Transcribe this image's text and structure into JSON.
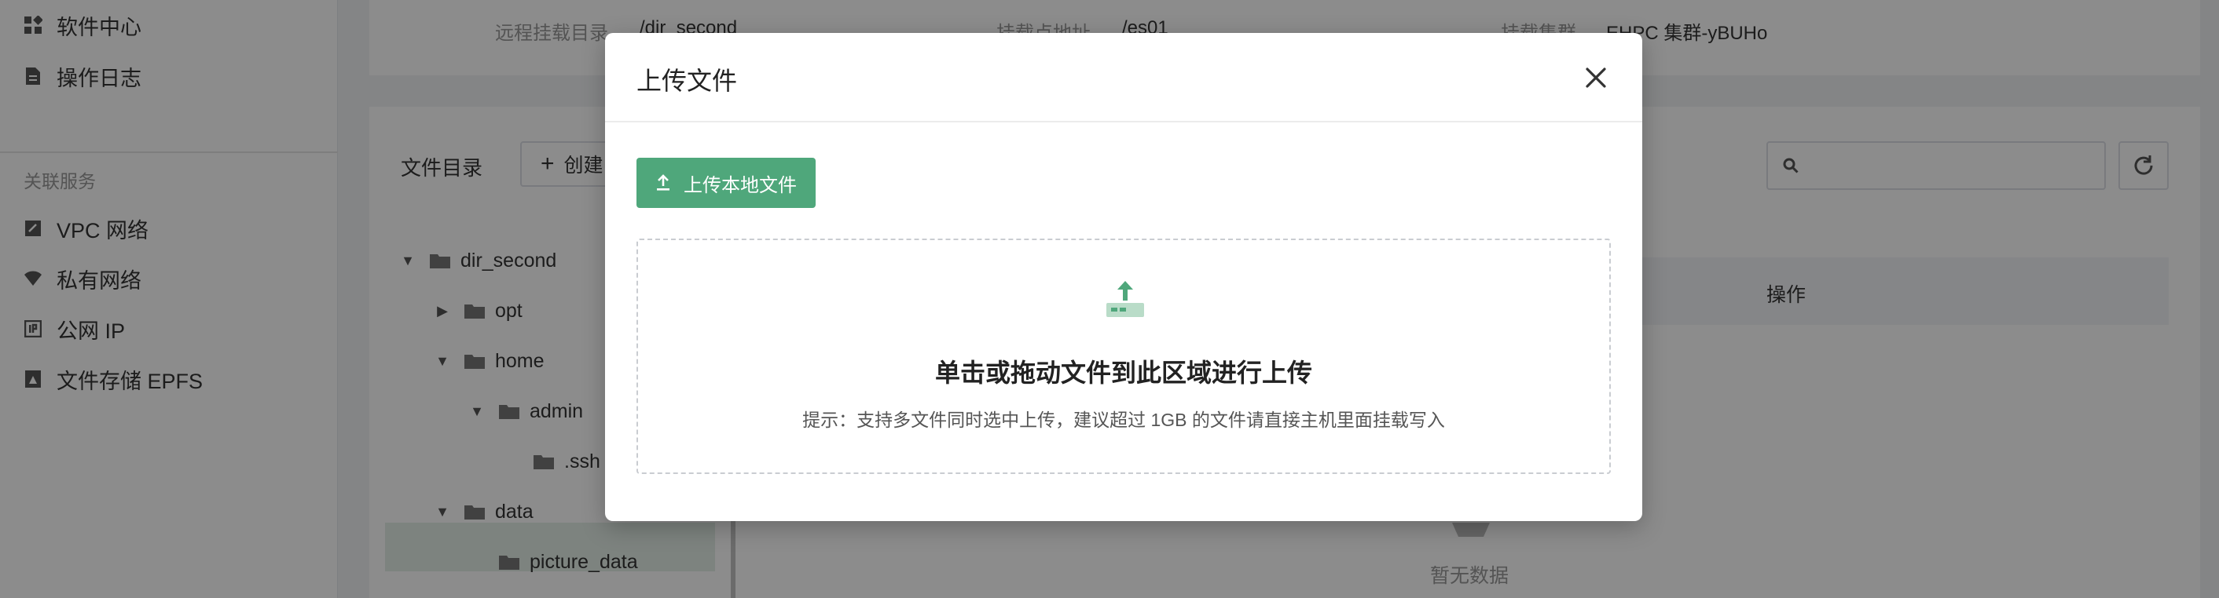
{
  "sidebar": {
    "items_top": [
      {
        "label": "软件中心",
        "icon": "apps-icon"
      },
      {
        "label": "操作日志",
        "icon": "log-icon"
      }
    ],
    "section_title": "关联服务",
    "items_related": [
      {
        "label": "VPC 网络",
        "icon": "vpc-icon"
      },
      {
        "label": "私有网络",
        "icon": "wifi-icon"
      },
      {
        "label": "公网 IP",
        "icon": "ip-icon"
      },
      {
        "label": "文件存储 EPFS",
        "icon": "storage-icon"
      }
    ]
  },
  "info": {
    "remote_dir_label": "远程挂载目录",
    "remote_dir_value": "/dir_second",
    "mount_addr_label": "挂载点地址",
    "mount_addr_value": "/es01",
    "cluster_label": "挂载集群",
    "cluster_value": "EHPC 集群-yBUHo"
  },
  "files": {
    "dir_label": "文件目录",
    "create_label": "创建",
    "tree": [
      {
        "label": "dir_second",
        "arrow": "▼"
      },
      {
        "label": "opt",
        "arrow": "▶"
      },
      {
        "label": "home",
        "arrow": "▼"
      },
      {
        "label": "admin",
        "arrow": "▼"
      },
      {
        "label": ".ssh",
        "arrow": ""
      },
      {
        "label": "data",
        "arrow": "▼"
      },
      {
        "label": "picture_data",
        "arrow": ""
      }
    ],
    "table_ops_header": "操作",
    "empty_text": "暂无数据"
  },
  "modal": {
    "title": "上传文件",
    "upload_button": "上传本地文件",
    "drop_title": "单击或拖动文件到此区域进行上传",
    "drop_hint": "提示：支持多文件同时选中上传，建议超过 1GB 的文件请直接主机里面挂载写入",
    "accent_color": "#4fa77b"
  }
}
